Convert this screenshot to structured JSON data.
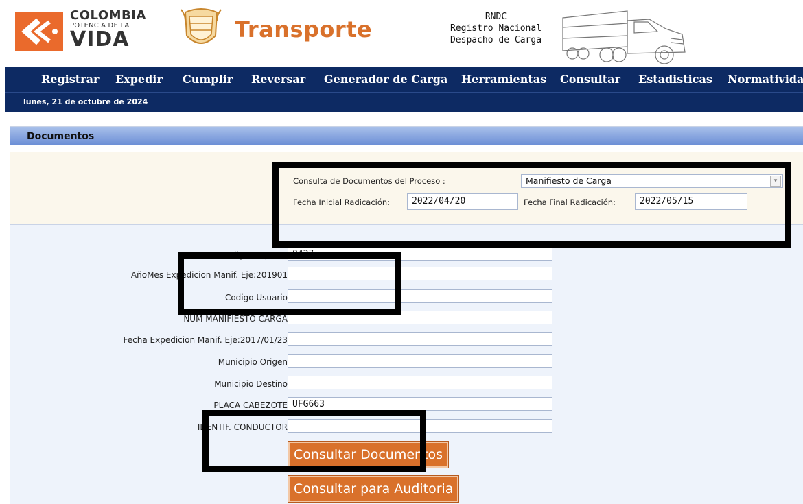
{
  "header": {
    "logo": {
      "line1": "COLOMBIA",
      "line2": "POTENCIA DE LA",
      "line3": "VIDA"
    },
    "ministry": "Transporte",
    "rndc": {
      "line1": "RNDC",
      "line2": "Registro  Nacional",
      "line3": "Despacho de Carga"
    }
  },
  "nav": {
    "items": [
      "Registrar",
      "Expedir",
      "Cumplir",
      "Reversar",
      "Generador de Carga",
      "Herramientas",
      "Consultar",
      "Estadisticas",
      "Normatividad"
    ],
    "date": "lunes, 21 de octubre de 2024"
  },
  "panel": {
    "title": "Documentos",
    "filter": {
      "process_label": "Consulta de Documentos del Proceso :",
      "process_value": "Manifiesto de Carga",
      "fecha_inicial_label": "Fecha Inicial Radicación:",
      "fecha_inicial_value": "2022/04/20",
      "fecha_final_label": "Fecha Final Radicación:",
      "fecha_final_value": "2022/05/15"
    },
    "fields": [
      {
        "label": "Codigo Empresa",
        "value": "0427"
      },
      {
        "label": "AñoMes Expedicion Manif. Eje:201901",
        "value": ""
      },
      {
        "label": "Codigo Usuario",
        "value": ""
      },
      {
        "label": "NUM MANIFIESTO CARGA",
        "value": ""
      },
      {
        "label": "Fecha Expedicion Manif. Eje:2017/01/23",
        "value": ""
      },
      {
        "label": "Municipio Origen",
        "value": ""
      },
      {
        "label": "Municipio Destino",
        "value": ""
      },
      {
        "label": "PLACA CABEZOTE",
        "value": "UFG663"
      },
      {
        "label": "IDENTIF. CONDUCTOR",
        "value": ""
      }
    ],
    "buttons": {
      "consultar_documentos": "Consultar Documentos",
      "consultar_auditoria": "Consultar para Auditoria"
    }
  },
  "colors": {
    "nav_bg": "#0d2a63",
    "accent_orange": "#d9712b",
    "panel_header": "#6d8fd6"
  }
}
